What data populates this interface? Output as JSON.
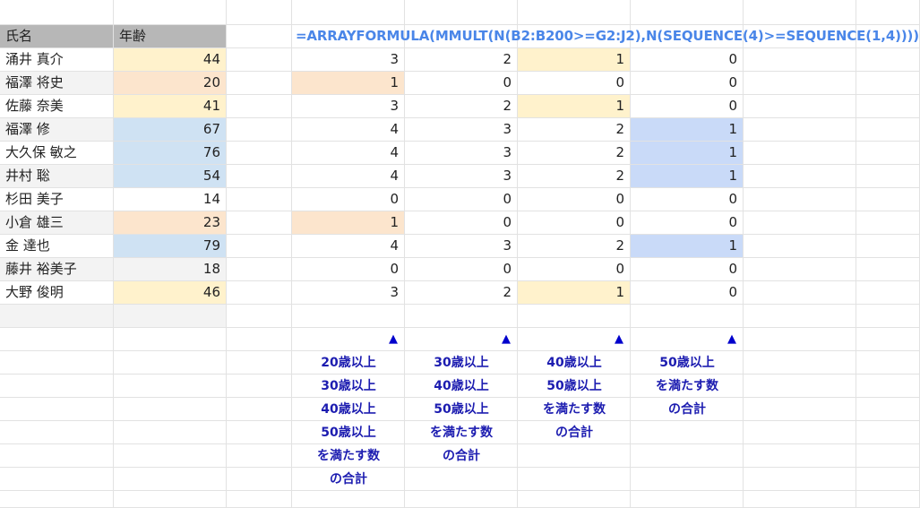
{
  "sheet": {
    "header": {
      "name": "氏名",
      "age": "年齢"
    },
    "people": [
      {
        "name": "涌井 真介",
        "age": "44",
        "age_color": "#fff2cc",
        "counts": [
          "3",
          "2",
          "1",
          "0"
        ],
        "highlight": [
          null,
          null,
          "#fff2cc",
          null
        ]
      },
      {
        "name": "福澤 将史",
        "age": "20",
        "age_color": "#fce5cd",
        "counts": [
          "1",
          "0",
          "0",
          "0"
        ],
        "highlight": [
          "#fce5cd",
          null,
          null,
          null
        ]
      },
      {
        "name": "佐藤 奈美",
        "age": "41",
        "age_color": "#fff2cc",
        "counts": [
          "3",
          "2",
          "1",
          "0"
        ],
        "highlight": [
          null,
          null,
          "#fff2cc",
          null
        ]
      },
      {
        "name": "福澤 修",
        "age": "67",
        "age_color": "#cfe2f3",
        "counts": [
          "4",
          "3",
          "2",
          "1"
        ],
        "highlight": [
          null,
          null,
          null,
          "#c9daf8"
        ]
      },
      {
        "name": "大久保 敏之",
        "age": "76",
        "age_color": "#cfe2f3",
        "counts": [
          "4",
          "3",
          "2",
          "1"
        ],
        "highlight": [
          null,
          null,
          null,
          "#c9daf8"
        ]
      },
      {
        "name": "井村 聡",
        "age": "54",
        "age_color": "#cfe2f3",
        "counts": [
          "4",
          "3",
          "2",
          "1"
        ],
        "highlight": [
          null,
          null,
          null,
          "#c9daf8"
        ]
      },
      {
        "name": "杉田 美子",
        "age": "14",
        "age_color": null,
        "counts": [
          "0",
          "0",
          "0",
          "0"
        ],
        "highlight": [
          null,
          null,
          null,
          null
        ]
      },
      {
        "name": "小倉 雄三",
        "age": "23",
        "age_color": "#fce5cd",
        "counts": [
          "1",
          "0",
          "0",
          "0"
        ],
        "highlight": [
          "#fce5cd",
          null,
          null,
          null
        ]
      },
      {
        "name": "金 達也",
        "age": "79",
        "age_color": "#cfe2f3",
        "counts": [
          "4",
          "3",
          "2",
          "1"
        ],
        "highlight": [
          null,
          null,
          null,
          "#c9daf8"
        ]
      },
      {
        "name": "藤井 裕美子",
        "age": "18",
        "age_color": null,
        "counts": [
          "0",
          "0",
          "0",
          "0"
        ],
        "highlight": [
          null,
          null,
          null,
          null
        ]
      },
      {
        "name": "大野 俊明",
        "age": "46",
        "age_color": "#fff2cc",
        "counts": [
          "3",
          "2",
          "1",
          "0"
        ],
        "highlight": [
          null,
          null,
          "#fff2cc",
          null
        ]
      }
    ],
    "formula": "=ARRAYFORMULA(MMULT(N(B2:B200>=G2:J2),N(SEQUENCE(4)>=SEQUENCE(1,4))))",
    "arrow_symbol": "▲",
    "labels": [
      [
        "20歳以上",
        "30歳以上",
        "40歳以上",
        "50歳以上",
        "を満たす数",
        "の合計"
      ],
      [
        "30歳以上",
        "40歳以上",
        "50歳以上",
        "を満たす数",
        "の合計"
      ],
      [
        "40歳以上",
        "50歳以上",
        "を満たす数",
        "の合計"
      ],
      [
        "50歳以上",
        "を満たす数",
        "の合計"
      ]
    ],
    "colors": {
      "header_gray": "#b7b7b7",
      "stripe_gray": "#f3f3f3",
      "formula_blue": "#4a86e8",
      "label_blue": "#1c1cb0",
      "arrow_blue": "#0000cc"
    }
  }
}
